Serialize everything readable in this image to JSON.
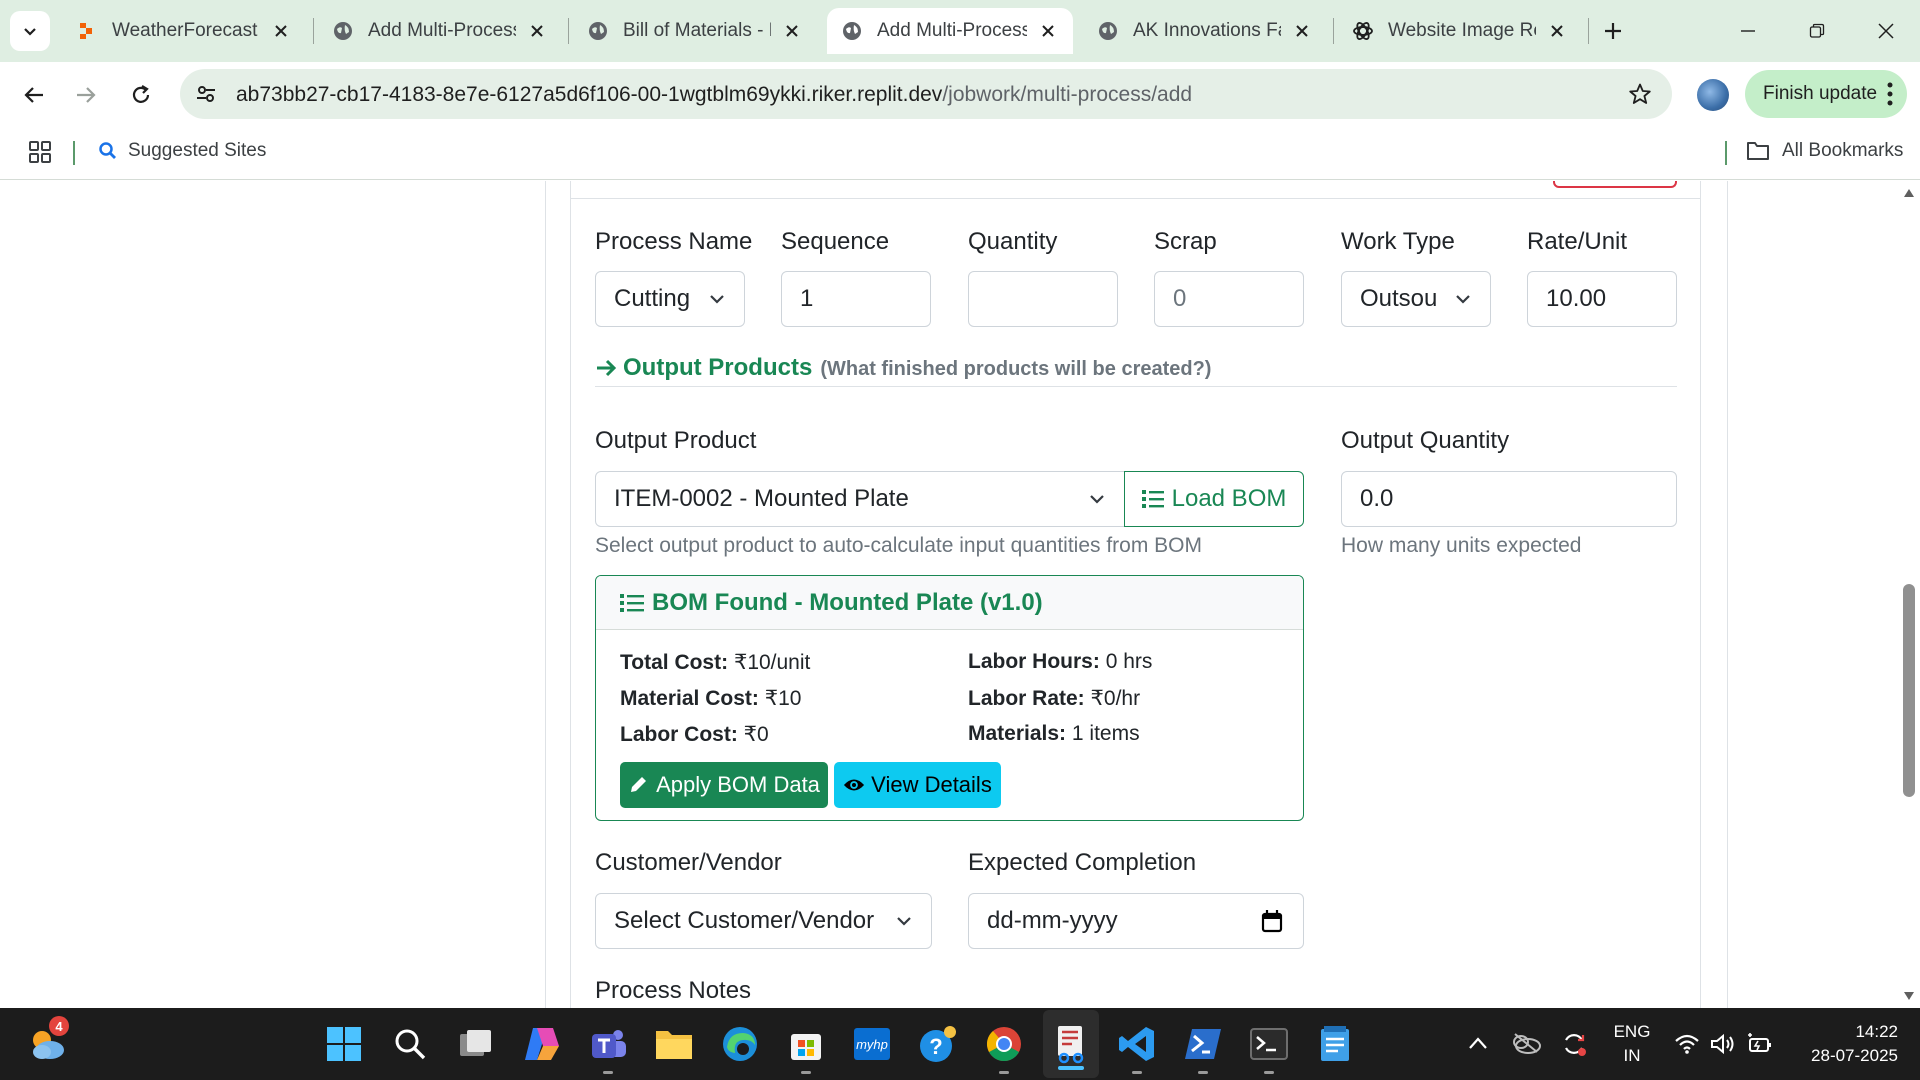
{
  "browser": {
    "tabs": [
      {
        "title": "WeatherForecast -",
        "active": false
      },
      {
        "title": "Add Multi-Process",
        "active": false
      },
      {
        "title": "Bill of Materials - F",
        "active": false
      },
      {
        "title": "Add Multi-Process",
        "active": true
      },
      {
        "title": "AK Innovations Fac",
        "active": false
      },
      {
        "title": "Website Image Rec",
        "active": false
      }
    ],
    "url_host": "ab73bb27-cb17-4183-8e7e-6127a5d6f106-00-1wgtblm69ykki.riker.replit.dev",
    "url_path": "/jobwork/multi-process/add",
    "finish_update_label": "Finish update",
    "bookmarks": {
      "suggested": "Suggested Sites",
      "all": "All Bookmarks"
    }
  },
  "process_row": {
    "process_name": {
      "label": "Process Name",
      "value": "Cutting"
    },
    "sequence": {
      "label": "Sequence",
      "value": "1"
    },
    "quantity": {
      "label": "Quantity",
      "value": ""
    },
    "scrap": {
      "label": "Scrap",
      "placeholder": "0"
    },
    "work_type": {
      "label": "Work Type",
      "value": "Outsou"
    },
    "rate_unit": {
      "label": "Rate/Unit",
      "value": "10.00"
    }
  },
  "output_section": {
    "title": "Output Products",
    "subtitle": "(What finished products will be created?)",
    "output_product": {
      "label": "Output Product",
      "value": "ITEM-0002 - Mounted Plate",
      "help": "Select output product to auto-calculate input quantities from BOM",
      "load_bom_label": "Load BOM"
    },
    "output_quantity": {
      "label": "Output Quantity",
      "value": "0.0",
      "help": "How many units expected"
    }
  },
  "bom_found": {
    "title": "BOM Found - Mounted Plate (v1.0)",
    "total_cost": {
      "key": "Total Cost:",
      "value": "₹10/unit"
    },
    "material_cost": {
      "key": "Material Cost:",
      "value": "₹10"
    },
    "labor_cost": {
      "key": "Labor Cost:",
      "value": "₹0"
    },
    "labor_hours": {
      "key": "Labor Hours:",
      "value": "0 hrs"
    },
    "labor_rate": {
      "key": "Labor Rate:",
      "value": "₹0/hr"
    },
    "materials": {
      "key": "Materials:",
      "value": "1 items"
    },
    "apply_label": "Apply BOM Data",
    "view_label": "View Details"
  },
  "customer": {
    "label": "Customer/Vendor",
    "value": "Select Customer/Vendor"
  },
  "expected_completion": {
    "label": "Expected Completion",
    "placeholder": "dd-mm-yyyy"
  },
  "process_notes": {
    "label": "Process Notes"
  },
  "taskbar": {
    "weather_badge": "4",
    "lang_top": "ENG",
    "lang_bottom": "IN",
    "time": "14:22",
    "date": "28-07-2025"
  },
  "colors": {
    "success": "#198754",
    "info": "#0dcaf0",
    "danger": "#dc3545",
    "chrome_tabbar": "#dfeee2"
  }
}
